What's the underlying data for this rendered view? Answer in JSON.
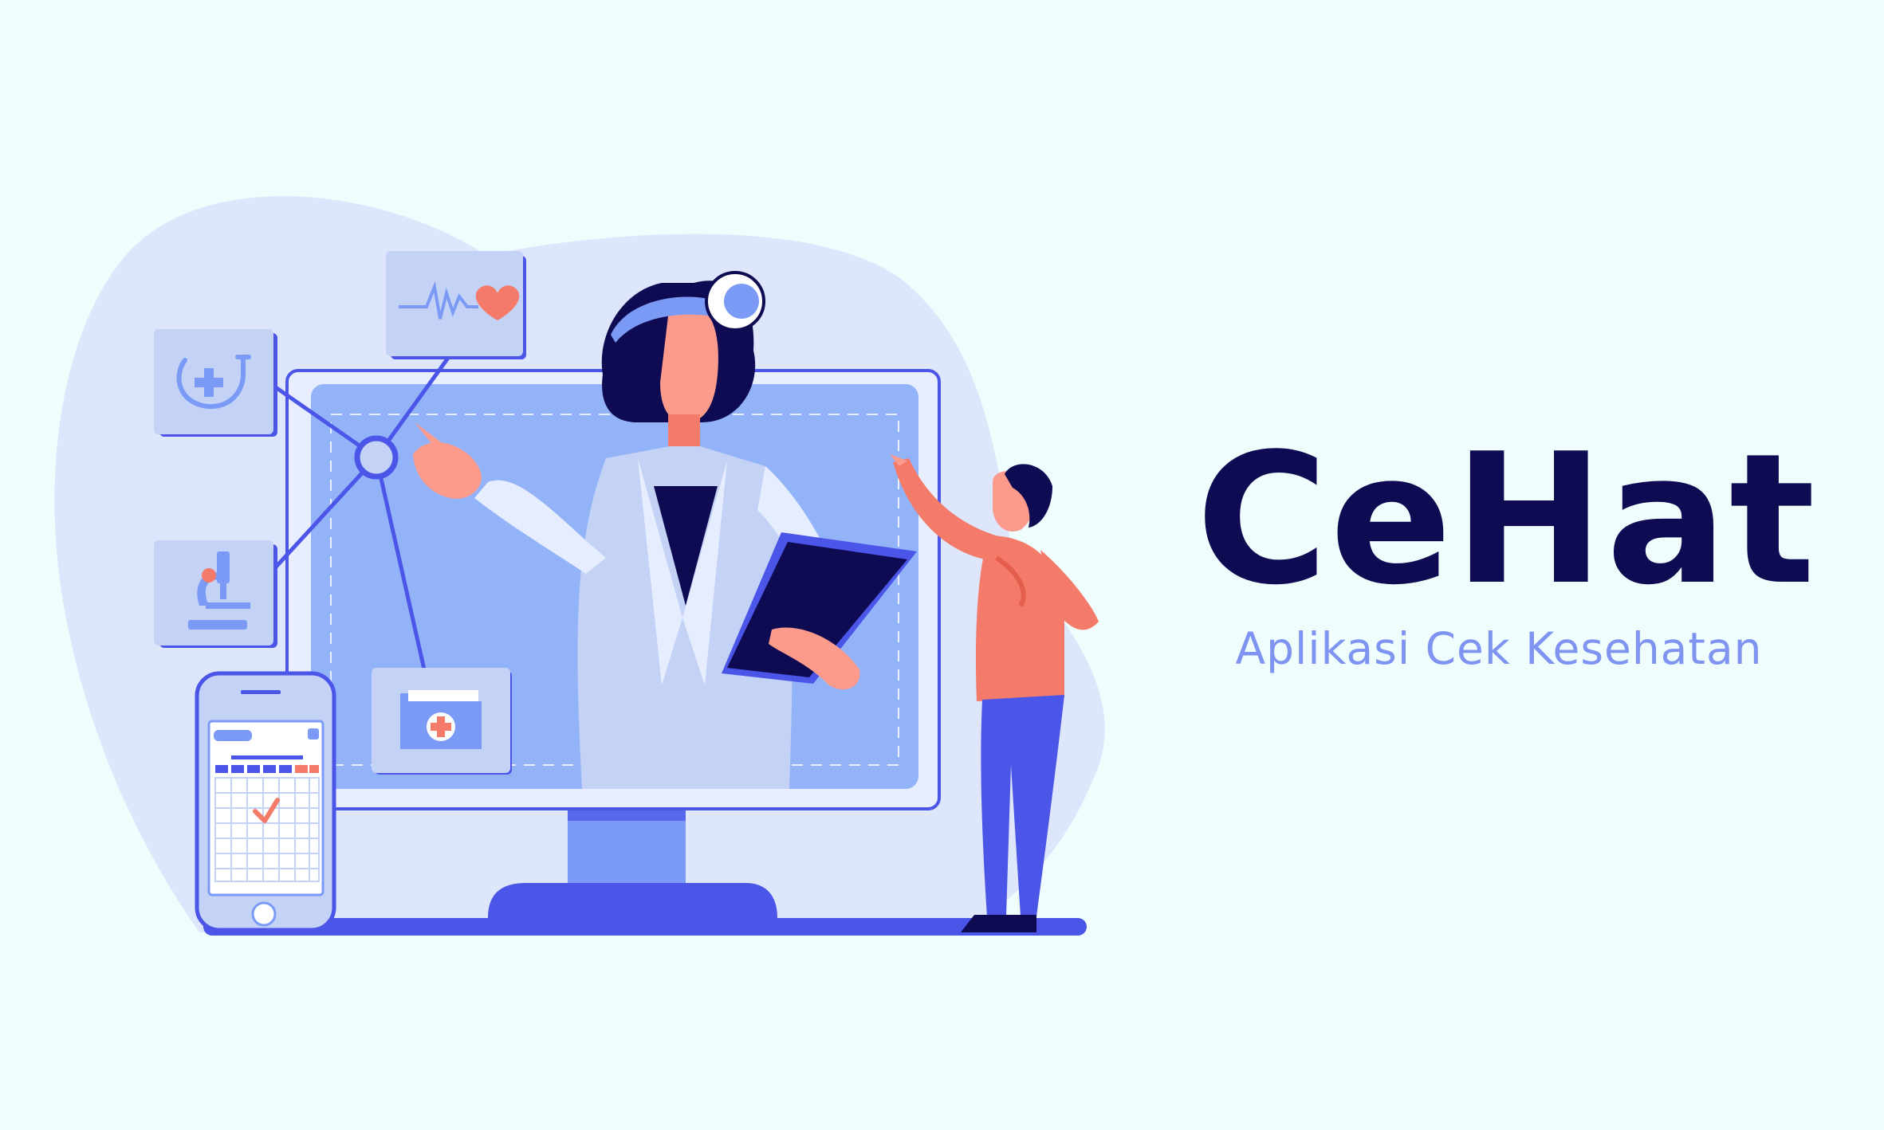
{
  "brand": {
    "title": "CeHat",
    "tagline": "Aplikasi Cek Kesehatan"
  },
  "colors": {
    "background": "#effdfd",
    "blob": "#dde6fb",
    "screen": "#93b3f8",
    "accent": "#4b55e8",
    "navy": "#0f0b52",
    "skin": "#fc9a8c",
    "shirt": "#f47a69",
    "coat": "#c3d2f5",
    "tagline": "#7f94f0"
  },
  "icons": [
    "stethoscope-icon",
    "heartbeat-icon",
    "microscope-icon",
    "medical-folder-icon",
    "calendar-phone-icon",
    "network-hub-icon"
  ]
}
